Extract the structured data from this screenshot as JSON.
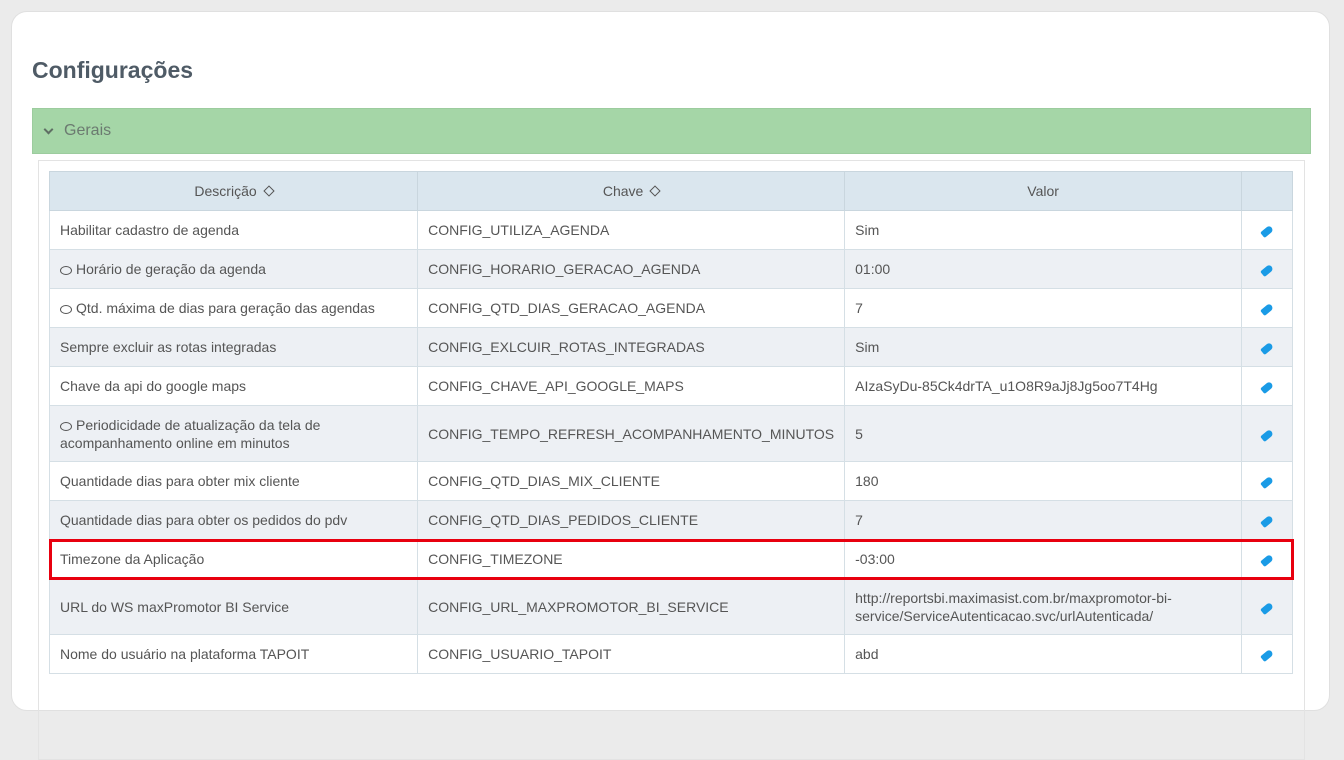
{
  "page": {
    "title": "Configurações"
  },
  "panel": {
    "title": "Gerais"
  },
  "table": {
    "headers": [
      "Descrição",
      "Chave",
      "Valor",
      ""
    ],
    "rows": [
      {
        "desc": "Habilitar cadastro de agenda",
        "key": "CONFIG_UTILIZA_AGENDA",
        "value": "Sim",
        "comment": false
      },
      {
        "desc": "Horário de geração da agenda",
        "key": "CONFIG_HORARIO_GERACAO_AGENDA",
        "value": "01:00",
        "comment": true
      },
      {
        "desc": "Qtd. máxima de dias para geração das agendas",
        "key": "CONFIG_QTD_DIAS_GERACAO_AGENDA",
        "value": "7",
        "comment": true
      },
      {
        "desc": "Sempre excluir as rotas integradas",
        "key": "CONFIG_EXLCUIR_ROTAS_INTEGRADAS",
        "value": "Sim",
        "comment": false
      },
      {
        "desc": "Chave da api do google maps",
        "key": "CONFIG_CHAVE_API_GOOGLE_MAPS",
        "value": "AIzaSyDu-85Ck4drTA_u1O8R9aJj8Jg5oo7T4Hg",
        "comment": false
      },
      {
        "desc": "Periodicidade de atualização da tela de acompanhamento online em minutos",
        "key": "CONFIG_TEMPO_REFRESH_ACOMPANHAMENTO_MINUTOS",
        "value": "5",
        "comment": true
      },
      {
        "desc": "Quantidade dias para obter mix cliente",
        "key": "CONFIG_QTD_DIAS_MIX_CLIENTE",
        "value": "180",
        "comment": false
      },
      {
        "desc": "Quantidade dias para obter os pedidos do pdv",
        "key": "CONFIG_QTD_DIAS_PEDIDOS_CLIENTE",
        "value": "7",
        "comment": false
      },
      {
        "desc": "Timezone da Aplicação",
        "key": "CONFIG_TIMEZONE",
        "value": "-03:00",
        "comment": false
      },
      {
        "desc": "URL do WS maxPromotor BI Service",
        "key": "CONFIG_URL_MAXPROMOTOR_BI_SERVICE",
        "value": "http://reportsbi.maximasist.com.br/maxpromotor-bi-service/ServiceAutenticacao.svc/urlAutenticada/",
        "comment": false
      },
      {
        "desc": "Nome do usuário na plataforma TAPOIT",
        "key": "CONFIG_USUARIO_TAPOIT",
        "value": "abd",
        "comment": false
      }
    ]
  }
}
